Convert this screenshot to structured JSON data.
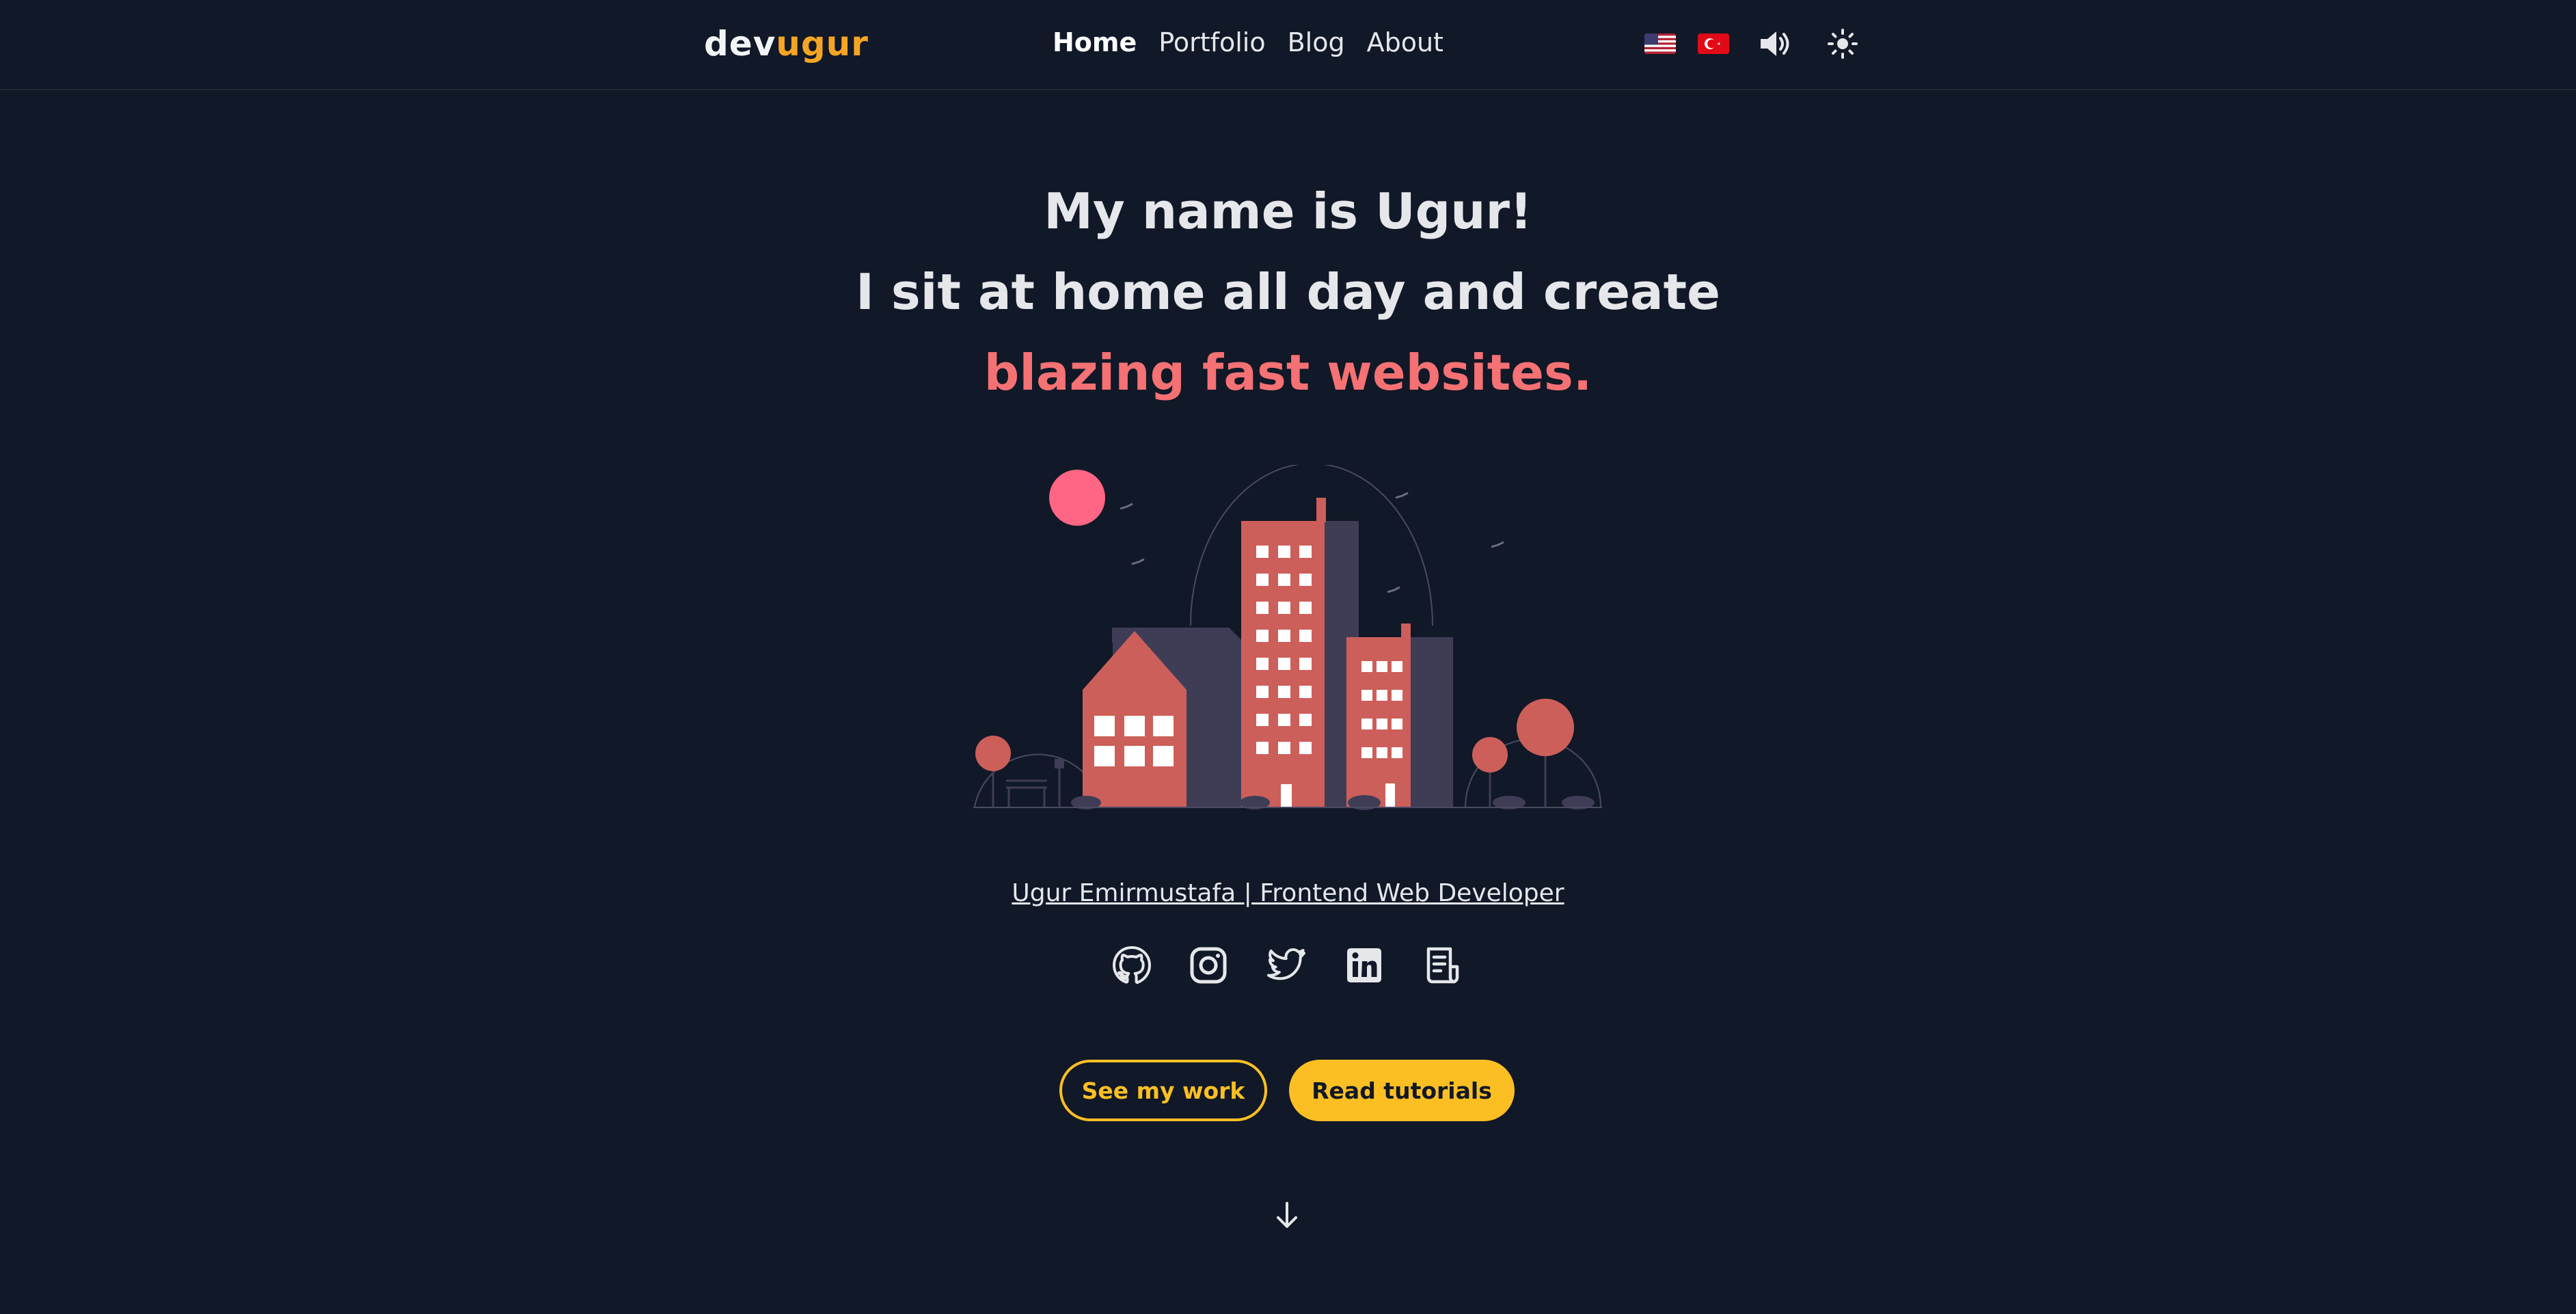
{
  "header": {
    "logo_prefix": "dev",
    "logo_suffix": "ugur",
    "nav": [
      {
        "label": "Home",
        "active": true
      },
      {
        "label": "Portfolio"
      },
      {
        "label": "Blog"
      },
      {
        "label": "About"
      }
    ],
    "icons": [
      "us-flag-icon",
      "turkey-flag-icon",
      "speaker-icon",
      "sun-icon"
    ]
  },
  "hero": {
    "line1": "My name is Ugur!",
    "line2": "I sit at home all day and create",
    "line3": "blazing fast websites."
  },
  "tagline": "Ugur Emirmustafa | Frontend Web Developer",
  "social_icons": [
    "github-icon",
    "instagram-icon",
    "twitter-icon",
    "linkedin-icon",
    "resume-icon"
  ],
  "actions": {
    "see_work": "See my work",
    "read_tutorials": "Read tutorials"
  },
  "colors": {
    "background": "#111827",
    "accent": "#fbbf24",
    "highlight": "#f47174",
    "building": "#cc5f5a"
  }
}
